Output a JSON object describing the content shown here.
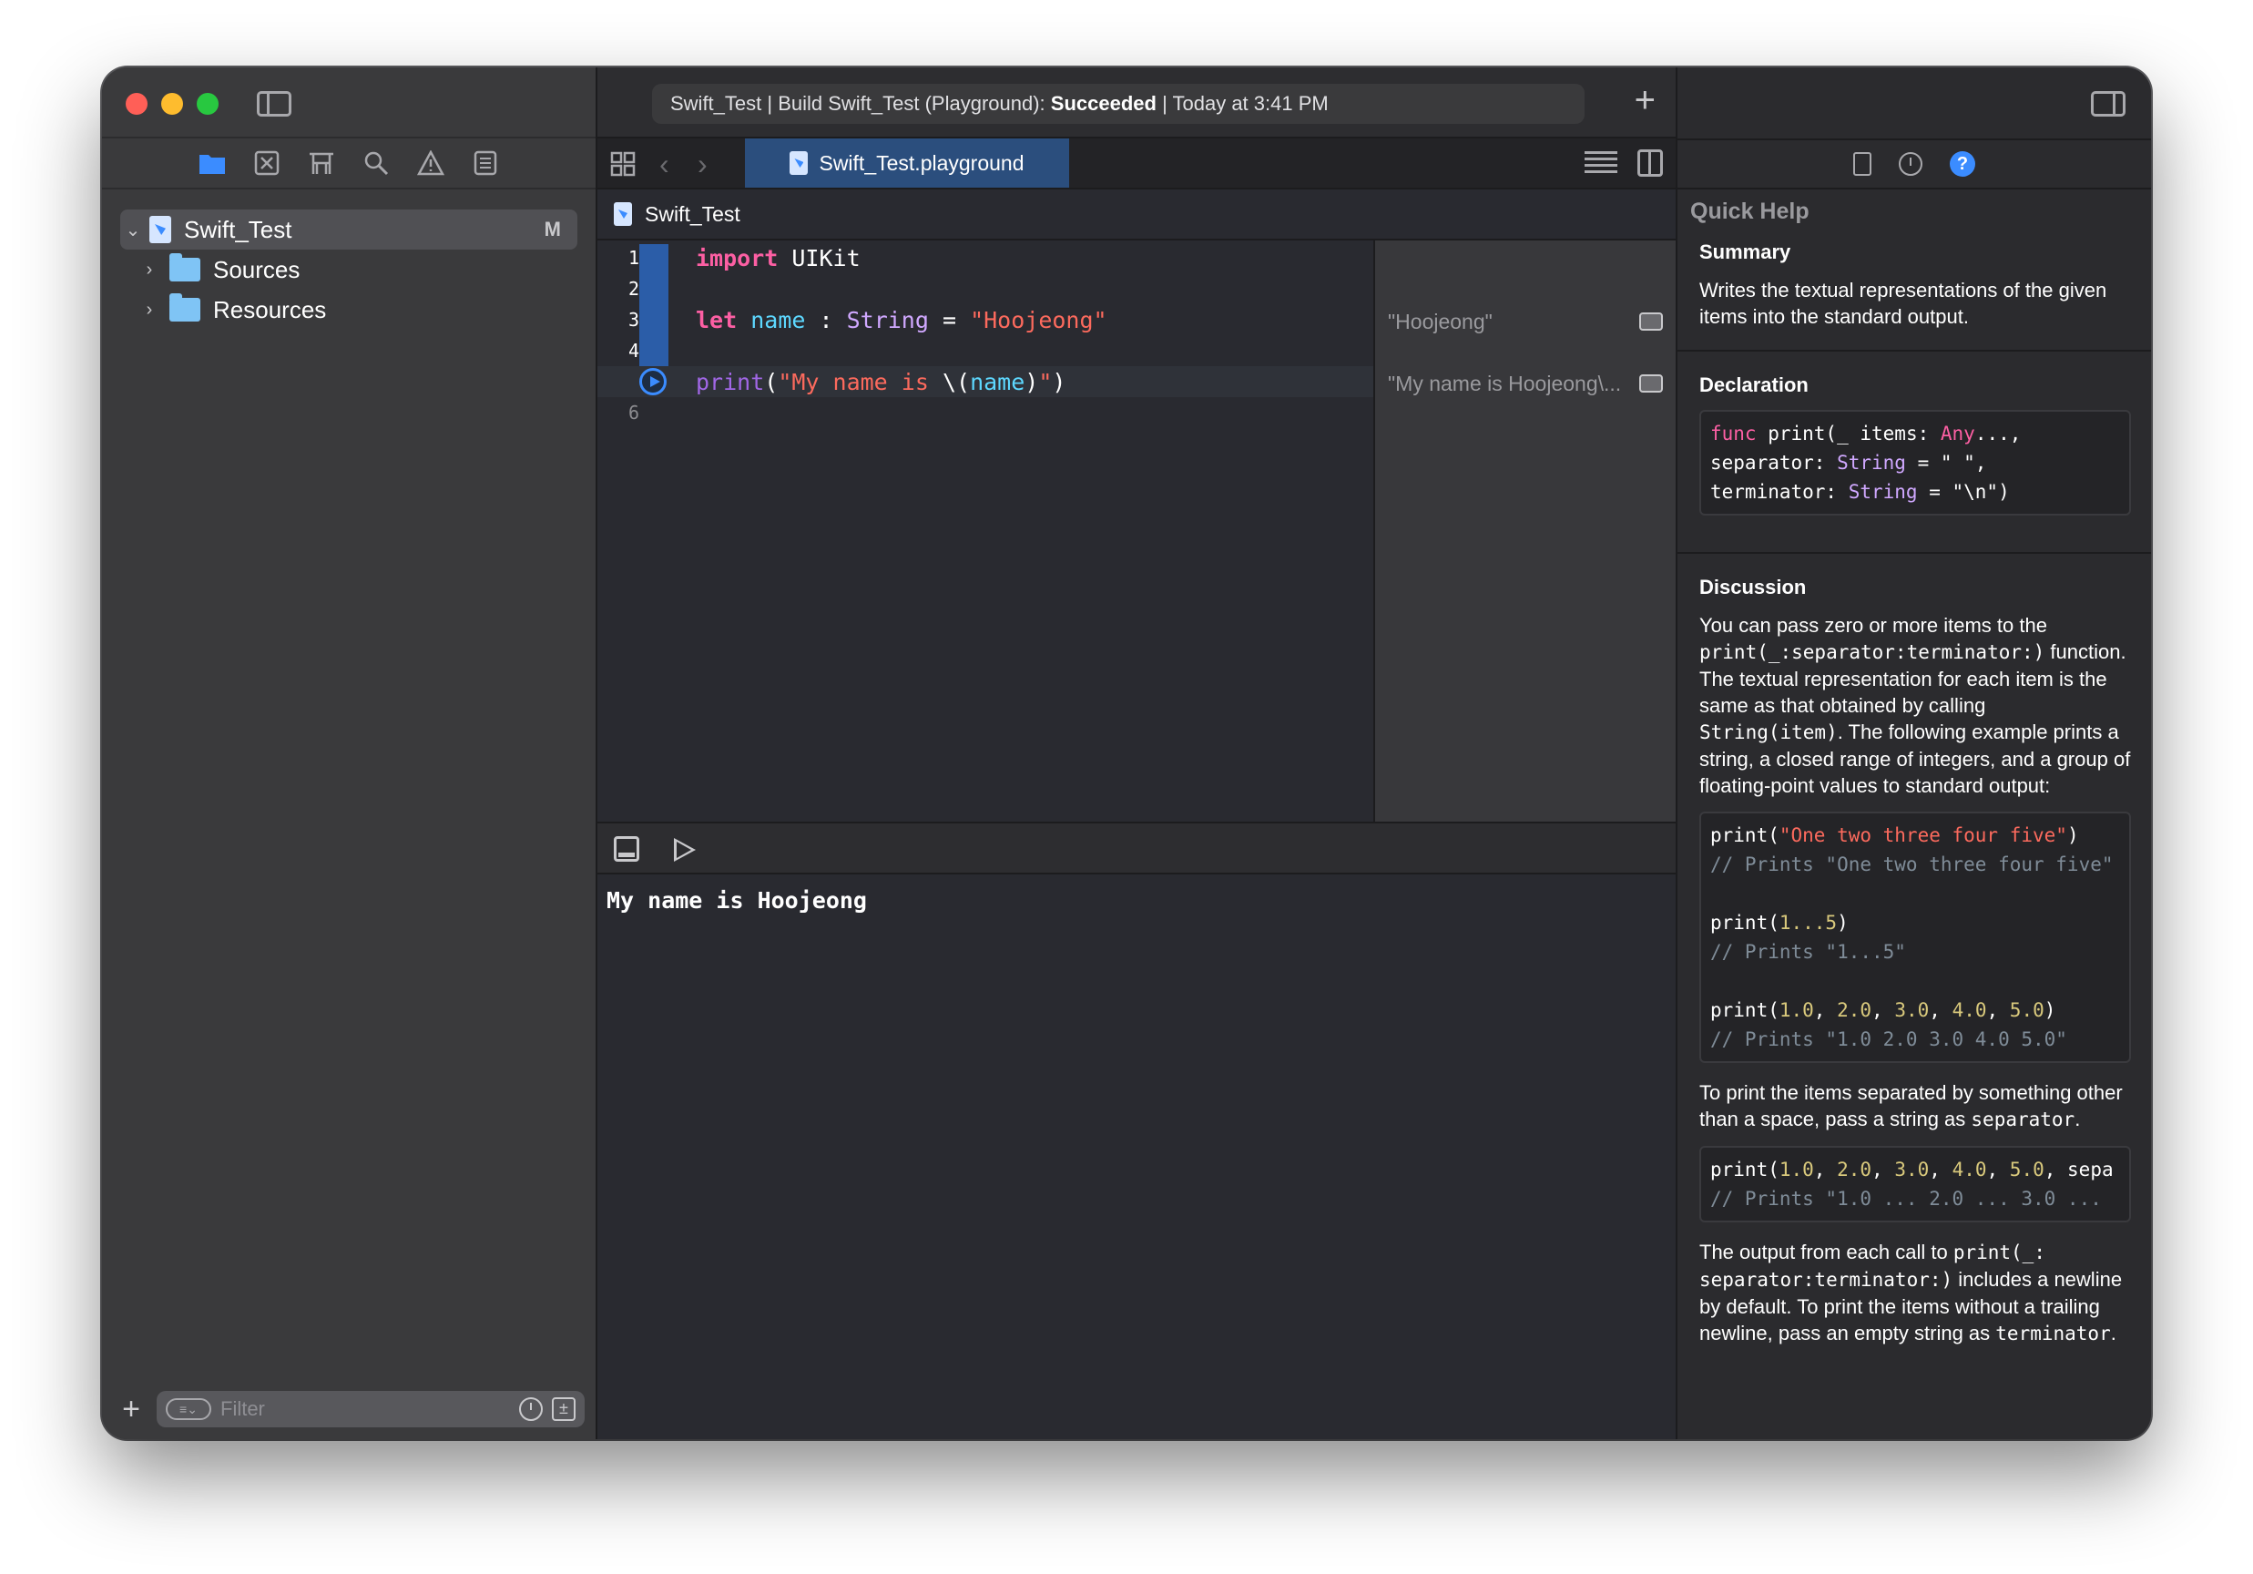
{
  "window": {
    "activity": {
      "prefix": "Swift_Test | Build Swift_Test (Playground): ",
      "status": "Succeeded",
      "suffix": " | Today at 3:41 PM"
    }
  },
  "navigator": {
    "tabs": [
      "project-navigator",
      "source-control-navigator",
      "symbol-navigator",
      "find-navigator",
      "issue-navigator",
      "report-navigator"
    ],
    "tree": [
      {
        "label": "Swift_Test",
        "badge": "M",
        "type": "playground",
        "expanded": true
      },
      {
        "label": "Sources",
        "type": "folder",
        "expanded": false
      },
      {
        "label": "Resources",
        "type": "folder",
        "expanded": false
      }
    ],
    "filter_placeholder": "Filter"
  },
  "editor": {
    "tab_label": "Swift_Test.playground",
    "breadcrumb": "Swift_Test",
    "line_numbers": [
      "1",
      "2",
      "3",
      "4",
      "",
      "6"
    ],
    "code": {
      "line1_kw": "import",
      "line1_rest": " UIKit",
      "line3_kw": "let",
      "line3_var": "name",
      "line3_colon": " : ",
      "line3_type": "String",
      "line3_eq": " = ",
      "line3_str": "\"Hoojeong\"",
      "line5_fn": "print",
      "line5_open": "(",
      "line5_str1": "\"My name is ",
      "line5_interp_open": "\\(",
      "line5_var": "name",
      "line5_interp_close": ")",
      "line5_str2": "\"",
      "line5_close": ")"
    },
    "results": [
      "\"Hoojeong\"",
      "\"My name is Hoojeong\\..."
    ],
    "console_output": "My name is Hoojeong"
  },
  "inspector": {
    "title": "Quick Help",
    "summary": {
      "heading": "Summary",
      "text": "Writes the textual representations of the given items into the standard output."
    },
    "declaration": {
      "heading": "Declaration",
      "func_kw": "func",
      "l1": " print(_ items: ",
      "any": "Any",
      "l1_end": "...,",
      "l2": "separator: ",
      "string1": "String",
      "l2_end": " = \" \",",
      "l3": "terminator: ",
      "string2": "String",
      "l3_end": " = \"\\n\")"
    },
    "discussion": {
      "heading": "Discussion",
      "p1_a": "You can pass zero or more items to the ",
      "p1_code1": "print(_:separator:terminator:)",
      "p1_b": " function. The textual representation for each item is the same as that obtained by calling ",
      "p1_code2": "String(item)",
      "p1_c": ". The following example prints a string, a closed range of integers, and a group of floating-point values to standard output:",
      "ex1_fn": "print(",
      "ex1_str": "\"One two three four five\"",
      "ex1_end": ")",
      "ex1_cm": "// Prints \"One two three four five\"",
      "ex2_fn": "print(",
      "ex2_num": "1...5",
      "ex2_end": ")",
      "ex2_cm": "// Prints \"1...5\"",
      "ex3_fn": "print(",
      "ex3_n1": "1.0",
      "ex3_n2": "2.0",
      "ex3_n3": "3.0",
      "ex3_n4": "4.0",
      "ex3_n5": "5.0",
      "ex3_sep": ", ",
      "ex3_end": ")",
      "ex3_cm": "// Prints \"1.0 2.0 3.0 4.0 5.0\"",
      "p2_a": "To print the items separated by something other than a space, pass a string as ",
      "p2_code": "separator",
      "p2_b": ".",
      "ex4_fn": "print(",
      "ex4_n1": "1.0",
      "ex4_n2": "2.0",
      "ex4_n3": "3.0",
      "ex4_n4": "4.0",
      "ex4_n5": "5.0",
      "ex4_sep": ", ",
      "ex4_tail": "sepa",
      "ex4_cm": "// Prints \"1.0 ... 2.0 ... 3.0 ...",
      "p3_a": "The output from each call to ",
      "p3_code1": "print(_:",
      "p3_code2": "separator:terminator:)",
      "p3_b": " includes a newline by default. To print the items without a trailing newline, pass an empty string as ",
      "p3_code3": "terminator",
      "p3_c": "."
    }
  },
  "colors": {
    "accent": "#3b8cff",
    "keyword": "#fc5fa3",
    "string": "#fc6a5d",
    "type": "#d0a8ff",
    "variable": "#5dd8ff",
    "number": "#d9c97c",
    "comment": "#7f8c98"
  }
}
